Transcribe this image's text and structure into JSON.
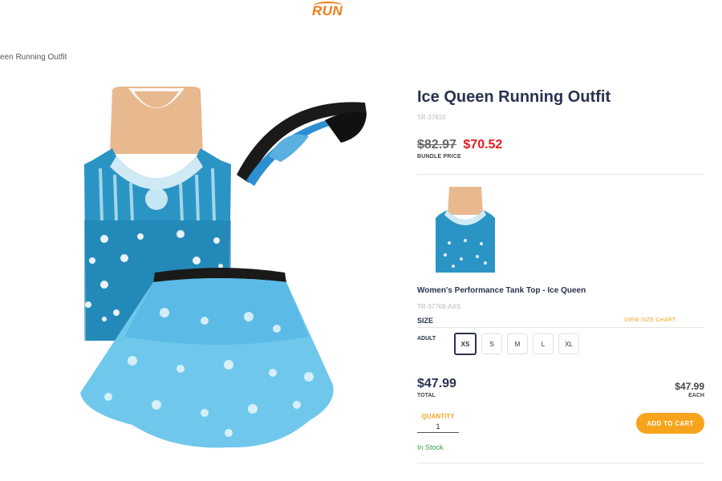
{
  "logo": {
    "text": "RUN",
    "icon": "run-logo-icon",
    "color": "#f07a1a"
  },
  "breadcrumb": {
    "current": "een Running Outfit"
  },
  "product": {
    "title": "Ice Queen Running Outfit",
    "sku": "TR-37810",
    "old_price": "$82.97",
    "new_price": "$70.52",
    "price_label": "BUNDLE PRICE"
  },
  "bundle_item": {
    "name": "Women's Performance Tank Top - Ice Queen",
    "sku": "TR-37768-AXS",
    "size_label": "SIZE",
    "size_chart_link": "VIEW SIZE CHART",
    "size_group": "ADULT",
    "sizes": [
      "XS",
      "S",
      "M",
      "L",
      "XL"
    ],
    "selected_size": "XS",
    "total_price": "$47.99",
    "total_label": "TOTAL",
    "each_price": "$47.99",
    "each_label": "EACH",
    "quantity_label": "QUANTITY",
    "quantity_value": "1",
    "add_to_cart": "ADD TO CART",
    "stock_status": "In Stock"
  },
  "colors": {
    "accent": "#f7a41d",
    "sale": "#e31b23",
    "heading": "#2a3250",
    "in_stock": "#3aa24a"
  }
}
